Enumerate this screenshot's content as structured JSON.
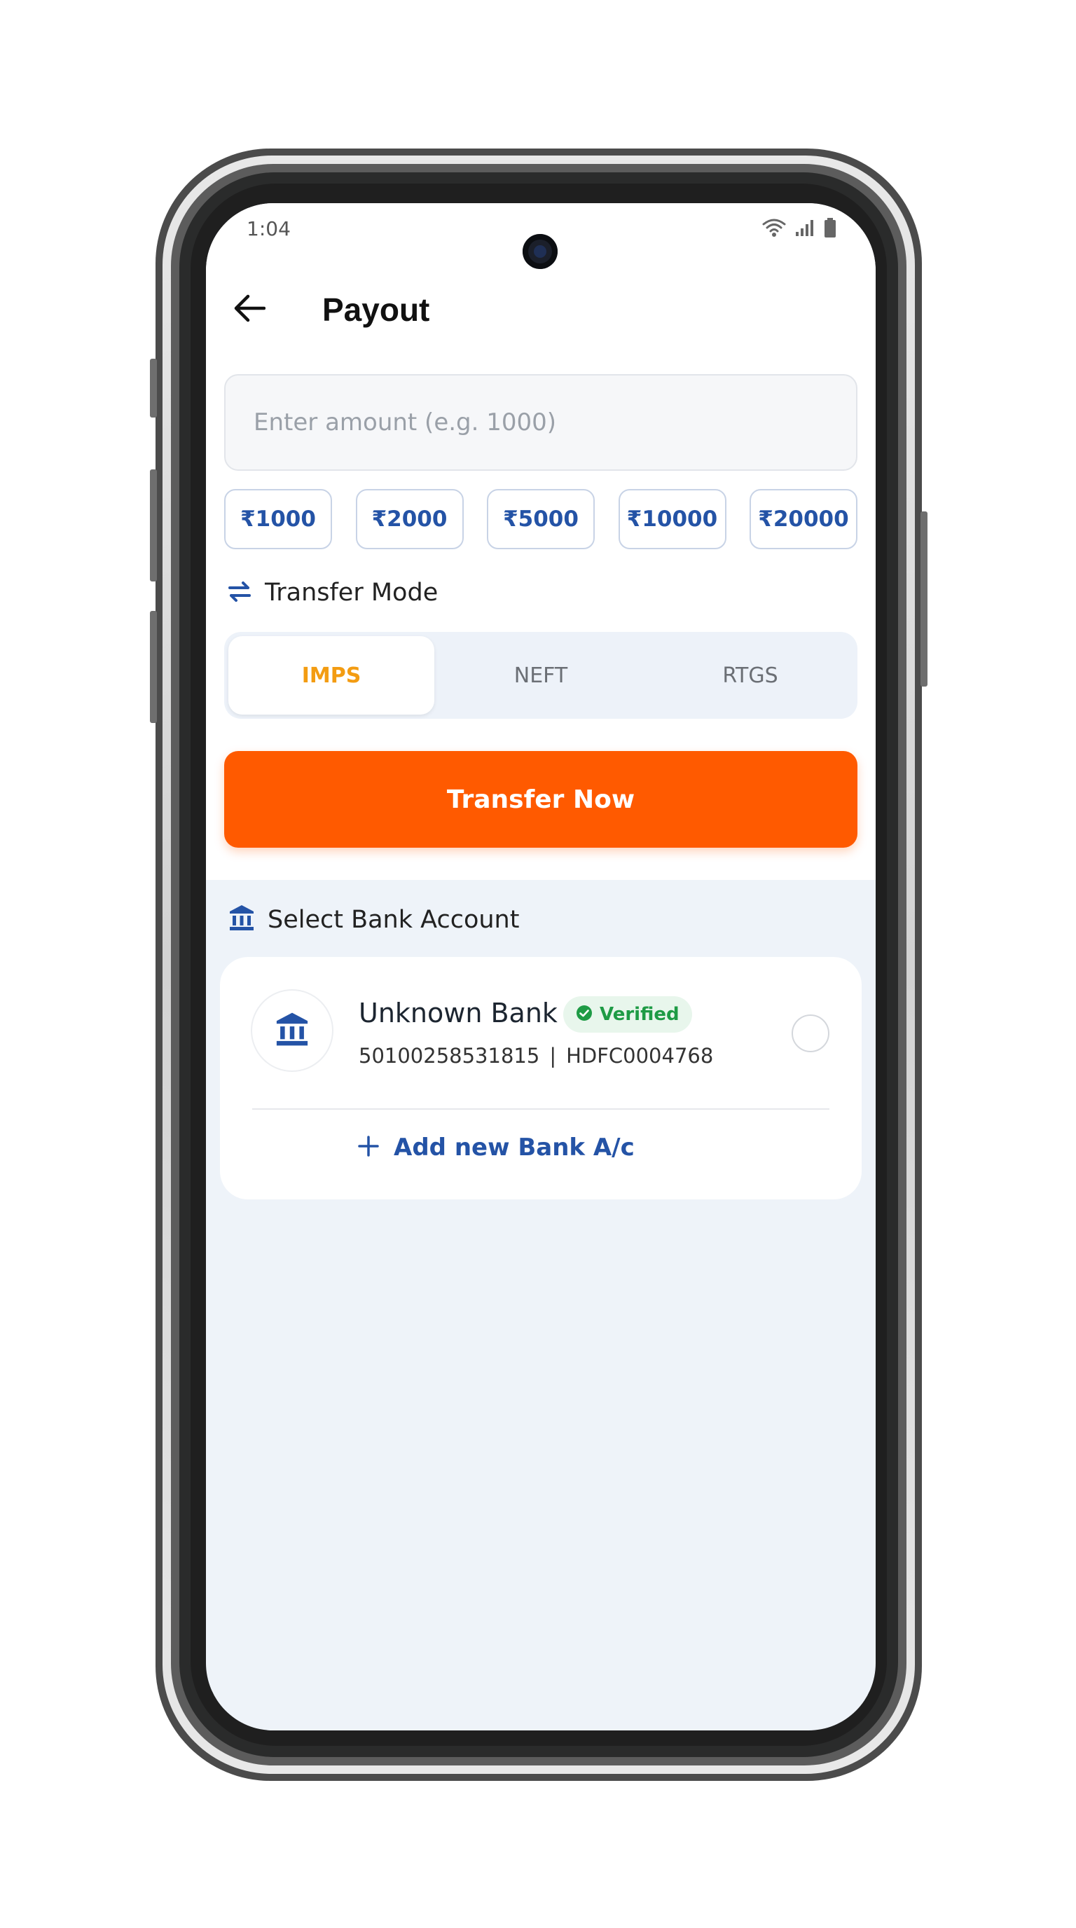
{
  "status_bar": {
    "time": "1:04",
    "icons": [
      "wifi-icon",
      "signal-icon",
      "battery-icon"
    ]
  },
  "header": {
    "title": "Payout",
    "back_icon": "arrow-left-icon"
  },
  "amount": {
    "value": "",
    "placeholder": "Enter amount (e.g. 1000)"
  },
  "quick_amounts": [
    "₹1000",
    "₹2000",
    "₹5000",
    "₹10000",
    "₹20000"
  ],
  "transfer_mode": {
    "title": "Transfer Mode",
    "icon": "transfer-arrows-icon",
    "options": [
      "IMPS",
      "NEFT",
      "RTGS"
    ],
    "selected": "IMPS"
  },
  "transfer_button": {
    "label": "Transfer Now"
  },
  "bank_section": {
    "title": "Select Bank Account",
    "icon": "bank-icon",
    "accounts": [
      {
        "bank_name": "Unknown Bank",
        "badge": "Verified",
        "account_number": "50100258531815",
        "separator": "|",
        "ifsc": "HDFC0004768",
        "selected": false
      }
    ],
    "add_label": "Add new Bank A/c"
  },
  "colors": {
    "brand_orange": "#ff5a00",
    "active_mode": "#f39c12",
    "primary_blue": "#2453a6",
    "verified_green": "#1e9b45",
    "background": "#eef3f9"
  }
}
